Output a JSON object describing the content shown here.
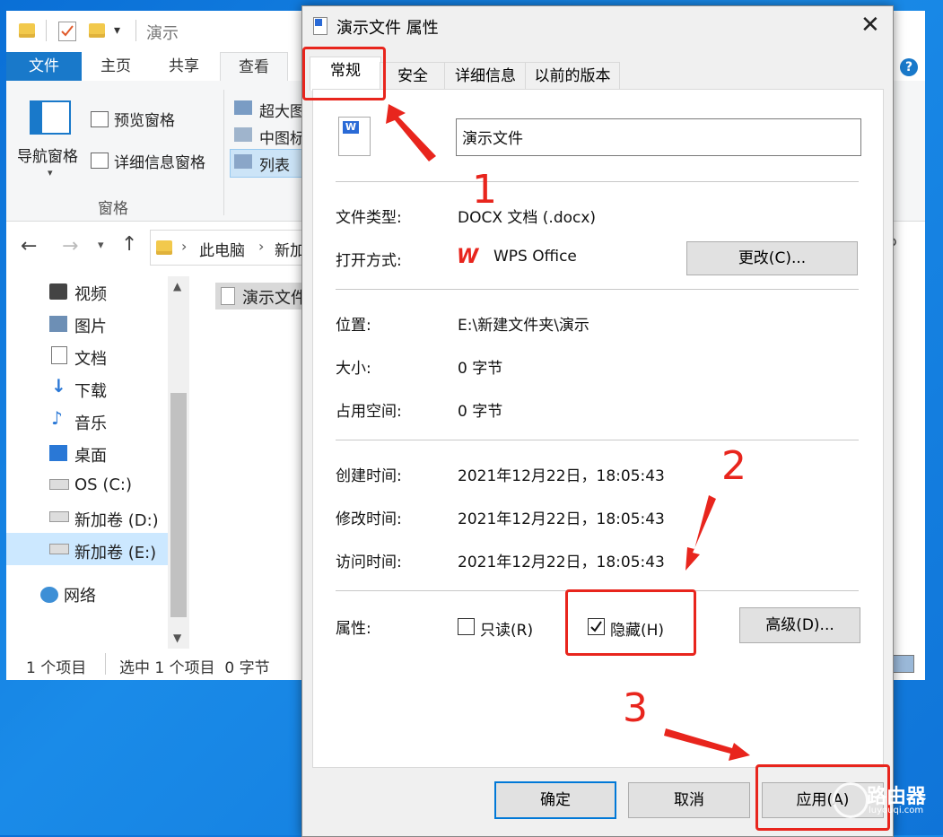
{
  "explorer": {
    "title": "演示",
    "tabs": [
      "文件",
      "主页",
      "共享",
      "查看"
    ],
    "ribbon": {
      "nav_pane": "导航窗格",
      "preview_pane": "预览窗格",
      "details_pane": "详细信息窗格",
      "group_label": "窗格",
      "layout_items": [
        "超大图",
        "中图标",
        "列表"
      ]
    },
    "breadcrumb": [
      "此电脑",
      "新加"
    ],
    "nav_items": [
      "视频",
      "图片",
      "文档",
      "下载",
      "音乐",
      "桌面",
      "OS (C:)",
      "新加卷 (D:)",
      "新加卷 (E:)",
      "网络"
    ],
    "file_item": "演示文件",
    "status": {
      "count": "1 个项目",
      "selected": "选中 1 个项目  0 字节"
    }
  },
  "dialog": {
    "title": "演示文件 属性",
    "tabs": [
      "常规",
      "安全",
      "详细信息",
      "以前的版本"
    ],
    "file_name": "演示文件",
    "file_type_label": "文件类型:",
    "file_type_value": "DOCX 文档 (.docx)",
    "open_with_label": "打开方式:",
    "open_with_value": "WPS Office",
    "change_button": "更改(C)...",
    "location_label": "位置:",
    "location_value": "E:\\新建文件夹\\演示",
    "size_label": "大小:",
    "size_value": "0 字节",
    "size_on_disk_label": "占用空间:",
    "size_on_disk_value": "0 字节",
    "created_label": "创建时间:",
    "created_value": "2021年12月22日，18:05:43",
    "modified_label": "修改时间:",
    "modified_value": "2021年12月22日，18:05:43",
    "accessed_label": "访问时间:",
    "accessed_value": "2021年12月22日，18:05:43",
    "attributes_label": "属性:",
    "readonly_label": "只读(R)",
    "hidden_label": "隐藏(H)",
    "advanced_button": "高级(D)...",
    "ok_button": "确定",
    "cancel_button": "取消",
    "apply_button": "应用(A)"
  },
  "annotations": {
    "step1": "1",
    "step2": "2",
    "step3": "3"
  },
  "watermark": {
    "text": "路由器",
    "sub": "luyouqi.com"
  },
  "colors": {
    "accent": "#0078d7",
    "annotation": "#e8251d",
    "file_tab": "#1979ca"
  }
}
